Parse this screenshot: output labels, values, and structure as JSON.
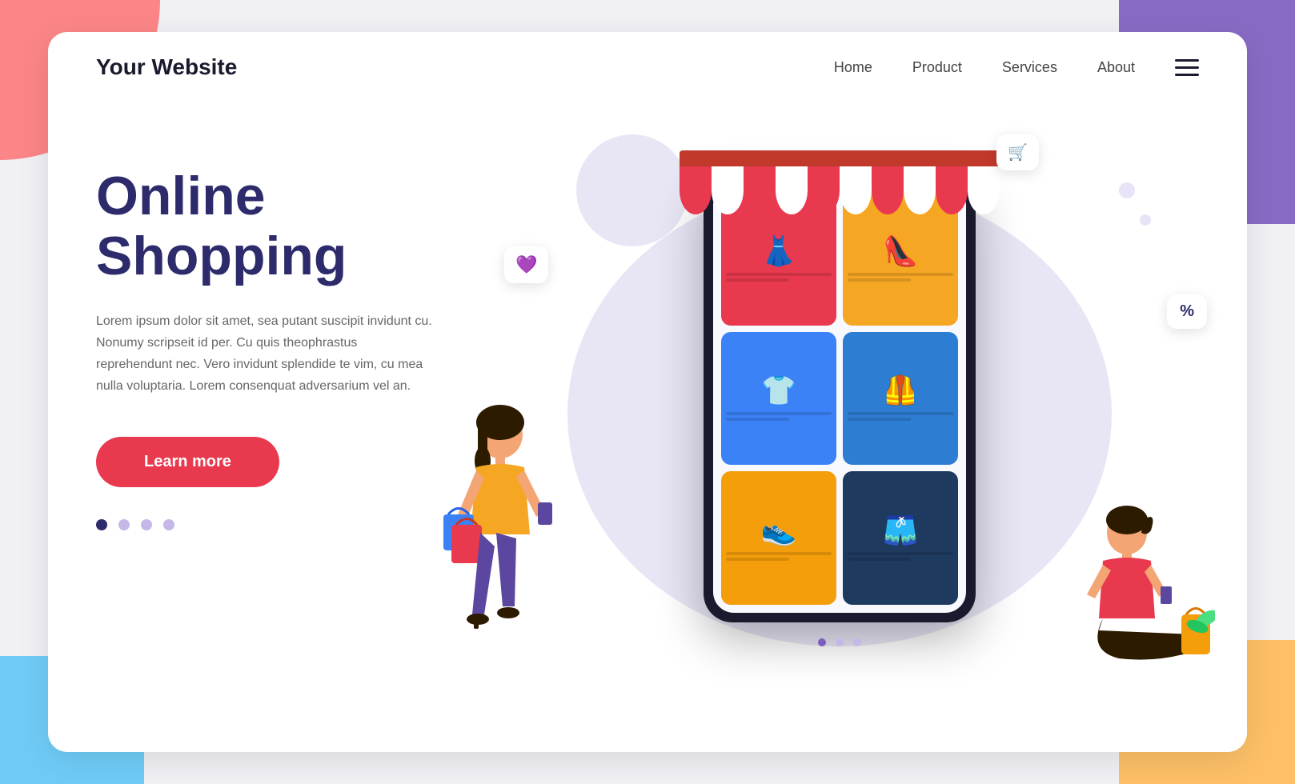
{
  "page": {
    "background": {
      "corners": {
        "tl_color": "#ff6b6b",
        "tr_color": "#7c5cbf",
        "bl_color": "#4fc3f7",
        "br_color": "#ffb74d"
      }
    }
  },
  "navbar": {
    "logo": "Your Website",
    "links": [
      {
        "id": "home",
        "label": "Home"
      },
      {
        "id": "product",
        "label": "Product"
      },
      {
        "id": "services",
        "label": "Services"
      },
      {
        "id": "about",
        "label": "About"
      }
    ]
  },
  "hero": {
    "title_line1": "Online",
    "title_line2": "Shopping",
    "description": "Lorem ipsum dolor sit amet, sea putant suscipit invidunt cu. Nonumy scripseit id per. Cu quis theophrastus reprehendunt nec. Vero invidunt splendide te vim, cu mea nulla voluptaria. Lorem consenquat adversarium vel an.",
    "cta_button": "Learn more",
    "dots": [
      {
        "state": "active"
      },
      {
        "state": "inactive"
      },
      {
        "state": "light"
      },
      {
        "state": "light"
      }
    ]
  },
  "phone": {
    "products": [
      {
        "id": "dress",
        "emoji": "👗",
        "color_class": "item-red"
      },
      {
        "id": "heels",
        "emoji": "👠",
        "color_class": "item-orange"
      },
      {
        "id": "tshirt",
        "emoji": "👕",
        "color_class": "item-blue"
      },
      {
        "id": "vest",
        "emoji": "🦺",
        "color_class": "item-teal"
      },
      {
        "id": "shoes",
        "emoji": "👟",
        "color_class": "item-orange2"
      },
      {
        "id": "shorts",
        "emoji": "🩳",
        "color_class": "item-navy"
      }
    ]
  },
  "bubbles": {
    "heart": "💜",
    "cart": "🛒",
    "percent": "%"
  },
  "awning": {
    "stripes": [
      "red",
      "white",
      "red",
      "white",
      "red",
      "white",
      "red",
      "white",
      "red",
      "white"
    ]
  }
}
